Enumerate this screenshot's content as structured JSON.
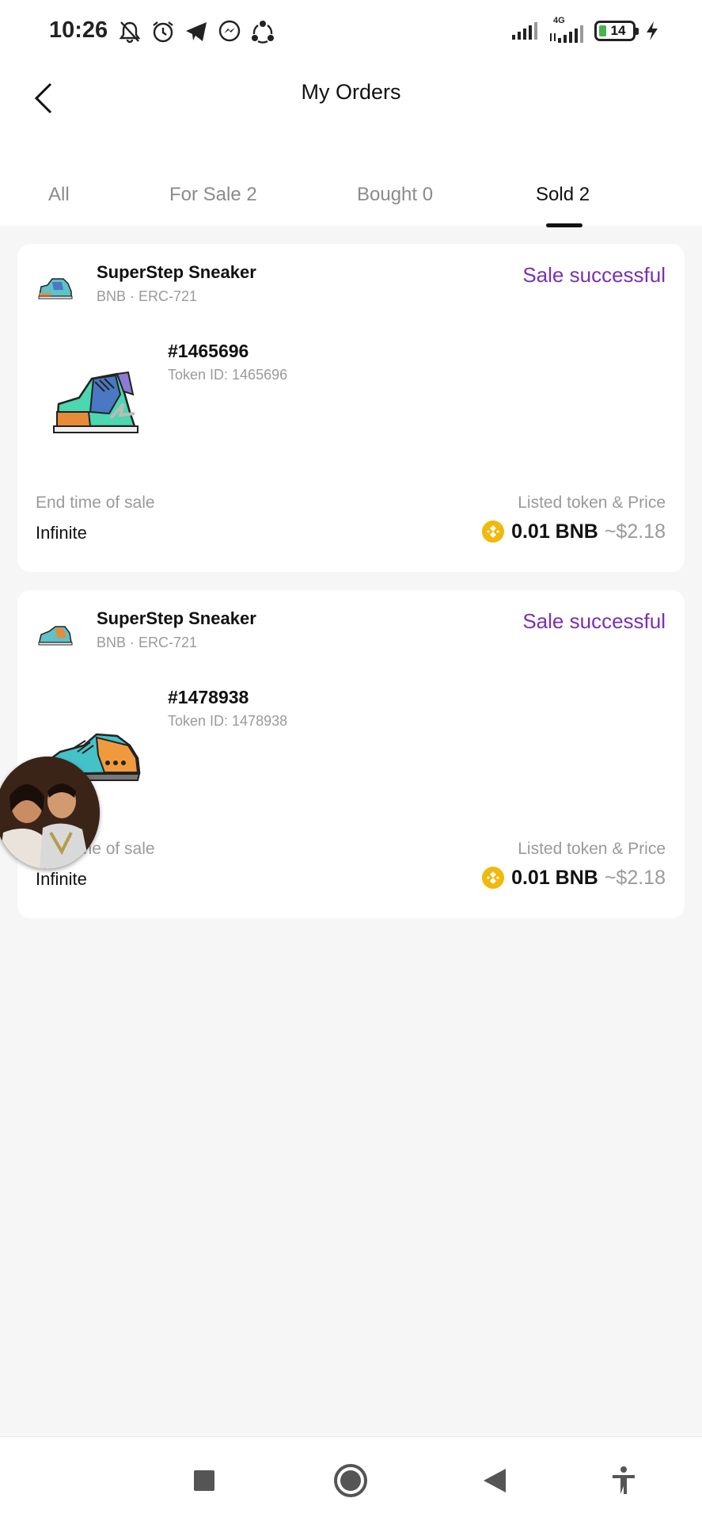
{
  "status_bar": {
    "time": "10:26",
    "battery_level": "14",
    "network": "4G",
    "icons_left": [
      "bell-off-icon",
      "alarm-icon",
      "telegram-icon",
      "messenger-icon",
      "sync-icon"
    ],
    "icons_right": [
      "signal-icon",
      "signal-4g-icon",
      "battery-icon",
      "charging-icon"
    ]
  },
  "header": {
    "title": "My Orders",
    "back_icon": "chevron-left-icon"
  },
  "tabs": [
    {
      "label": "All",
      "active": false
    },
    {
      "label": "For Sale 2",
      "active": false
    },
    {
      "label": "Bought 0",
      "active": false
    },
    {
      "label": "Sold 2",
      "active": true
    }
  ],
  "orders": [
    {
      "collection_name": "SuperStep Sneaker",
      "collection_sub": "BNB · ERC-721",
      "status": "Sale successful",
      "nft_number": "#1465696",
      "token_id": "Token ID: 1465696",
      "end_label": "End time of sale",
      "end_value": "Infinite",
      "price_label": "Listed token & Price",
      "price_amount": "0.01 BNB",
      "price_usd": "~$2.18"
    },
    {
      "collection_name": "SuperStep Sneaker",
      "collection_sub": "BNB · ERC-721",
      "status": "Sale successful",
      "nft_number": "#1478938",
      "token_id": "Token ID: 1478938",
      "end_label": "End time of sale",
      "end_value": "Infinite",
      "price_label": "Listed token & Price",
      "price_amount": "0.01 BNB",
      "price_usd": "~$2.18"
    }
  ],
  "colors": {
    "status_success": "#7a2fb5",
    "bnb": "#f0b90b",
    "background": "#f6f6f7"
  },
  "navbar": {
    "icons": [
      "recents-square-icon",
      "home-circle-icon",
      "back-triangle-icon",
      "accessibility-icon"
    ]
  }
}
